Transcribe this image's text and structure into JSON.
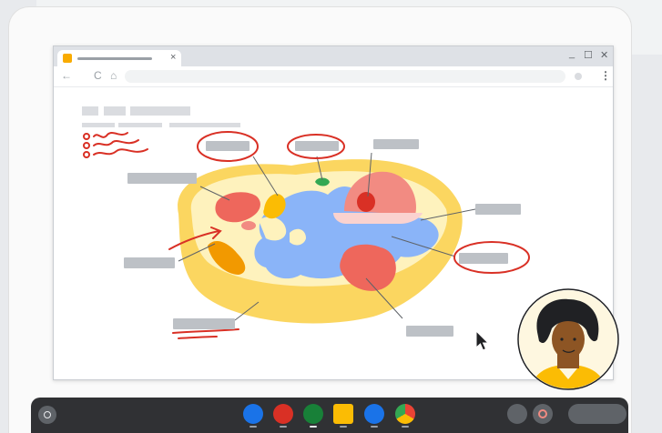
{
  "colors": {
    "cell_membrane": "#fbd660",
    "cytoplasm": "#fef2bd",
    "er": "#8ab4f8",
    "nucleus": "#f28b82",
    "annotation_ink": "#d93025",
    "shelf": "#303134"
  },
  "browser": {
    "tab": {
      "favicon": "slides-icon",
      "close_glyph": "×"
    },
    "window_controls": {
      "minimize": "_",
      "maximize": "☐",
      "close": "✕"
    },
    "nav": {
      "back": "←",
      "reload": "C",
      "home": "⌂"
    },
    "menu_glyph": "⋮"
  },
  "shelf": {
    "apps": [
      {
        "name": "files-icon",
        "color": "#1a73e8"
      },
      {
        "name": "canvas-icon",
        "color": "#d93025"
      },
      {
        "name": "classroom-reader-icon",
        "color": "#188038"
      },
      {
        "name": "classroom-icon",
        "color": "#188038"
      },
      {
        "name": "camera-icon",
        "color": "#1a73e8"
      },
      {
        "name": "chrome-icon",
        "color": "#fbbc04"
      }
    ],
    "tray": [
      "stylus-icon",
      "screen-record-icon"
    ]
  },
  "cursor": "pointer-arrow-icon",
  "video_tile": "presenter-avatar"
}
